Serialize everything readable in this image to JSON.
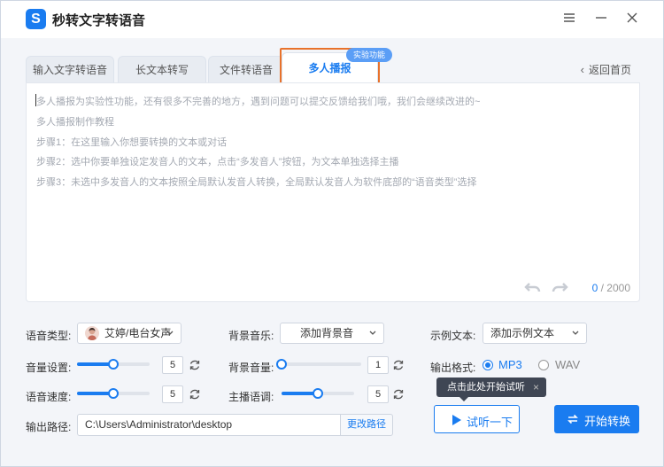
{
  "app": {
    "title": "秒转文字转语音",
    "logo_letter": "S"
  },
  "window_controls": [
    "menu-icon",
    "minimize-icon",
    "close-icon"
  ],
  "tabs": [
    {
      "label": "输入文字转语音",
      "active": false
    },
    {
      "label": "长文本转写",
      "active": false
    },
    {
      "label": "文件转语音",
      "active": false
    },
    {
      "label": "多人播报",
      "active": true
    }
  ],
  "beta_badge": "实验功能",
  "back_link": "返回首页",
  "editor": {
    "lines": [
      "多人播报为实验性功能，还有很多不完善的地方，遇到问题可以提交反馈给我们哦，我们会继续改进的~",
      "多人播报制作教程",
      "步骤1：在这里输入你想要转换的文本或对话",
      "步骤2：选中你要单独设定发音人的文本，点击“多发音人”按钮，为文本单独选择主播",
      "步骤3：未选中多发音人的文本按照全局默认发音人转换，全局默认发音人为软件底部的“语音类型”选择"
    ],
    "char_count": "0",
    "char_limit": "/ 2000"
  },
  "settings": {
    "voice_type_label": "语音类型:",
    "voice_type_value": "艾婷/电台女声",
    "bgm_label": "背景音乐:",
    "bgm_value": "添加背景音",
    "example_label": "示例文本:",
    "example_value": "添加示例文本",
    "volume_label": "音量设置:",
    "volume_value": "5",
    "volume_level": 0.5,
    "bg_volume_label": "背景音量:",
    "bg_volume_value": "1",
    "bg_volume_level": 0.0,
    "format_label": "输出格式:",
    "format_options": [
      {
        "label": "MP3",
        "selected": true
      },
      {
        "label": "WAV",
        "selected": false
      }
    ],
    "speed_label": "语音速度:",
    "speed_value": "5",
    "speed_level": 0.5,
    "tone_label": "主播语调:",
    "tone_value": "5",
    "tone_level": 0.5,
    "output_path_label": "输出路径:",
    "output_path_value": "C:\\Users\\Administrator\\desktop",
    "change_path_label": "更改路径"
  },
  "tooltip": {
    "text": "点击此处开始试听",
    "close": "×"
  },
  "buttons": {
    "listen": "试听一下",
    "start": "开始转换"
  },
  "colors": {
    "accent": "#1a7cf0",
    "highlight": "#e8722b"
  }
}
